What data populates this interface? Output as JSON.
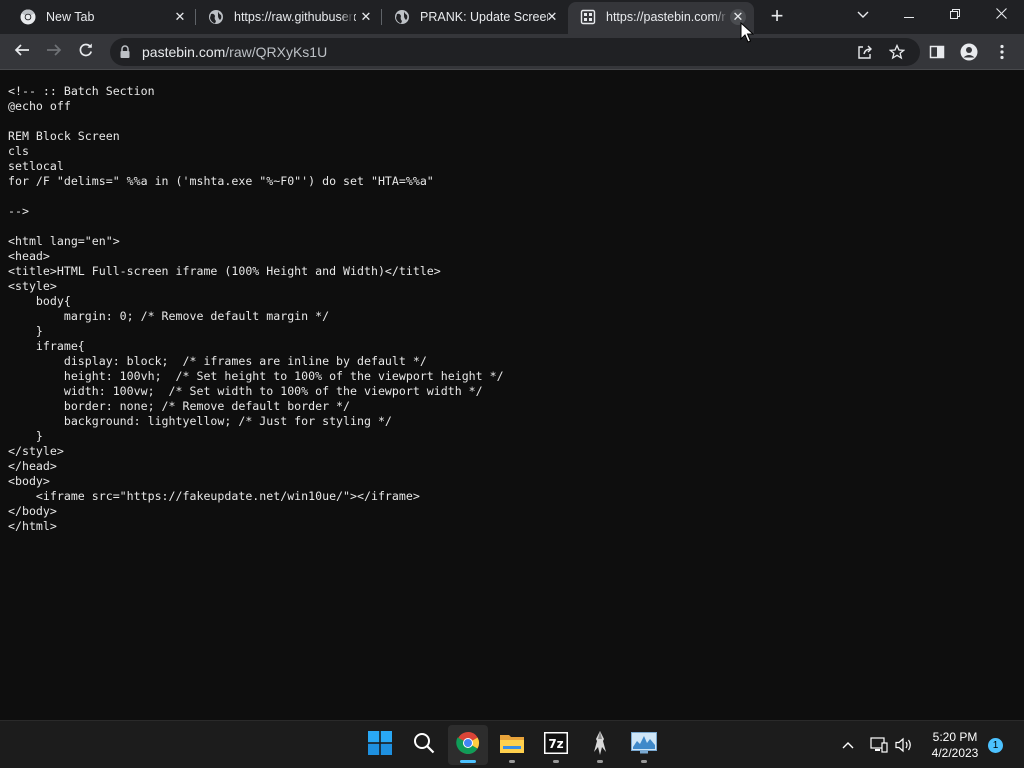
{
  "tabs": [
    {
      "title": "New Tab",
      "favicon": "chrome-icon"
    },
    {
      "title": "https://raw.githubuserc",
      "favicon": "globe-icon"
    },
    {
      "title": "PRANK: Update Screen",
      "favicon": "globe-icon"
    },
    {
      "title": "https://pastebin.com/r",
      "favicon": "pastebin-icon"
    }
  ],
  "toolbar": {
    "url_host": "pastebin.com",
    "url_path": "/raw/QRXyKs1U"
  },
  "page": {
    "lines": [
      "<!-- :: Batch Section",
      "@echo off",
      "",
      "REM Block Screen",
      "cls",
      "setlocal",
      "for /F \"delims=\" %%a in ('mshta.exe \"%~F0\"') do set \"HTA=%%a\"",
      "",
      "-->",
      "",
      "<html lang=\"en\">",
      "<head>",
      "<title>HTML Full-screen iframe (100% Height and Width)</title>",
      "<style>",
      "    body{",
      "        margin: 0; /* Remove default margin */",
      "    }",
      "    iframe{",
      "        display: block;  /* iframes are inline by default */",
      "        height: 100vh;  /* Set height to 100% of the viewport height */",
      "        width: 100vw;  /* Set width to 100% of the viewport width */",
      "        border: none; /* Remove default border */",
      "        background: lightyellow; /* Just for styling */",
      "    }",
      "</style>",
      "</head>",
      "<body>",
      "    <iframe src=\"https://fakeupdate.net/win10ue/\"></iframe>",
      "</body>",
      "</html>"
    ]
  },
  "taskbar": {
    "apps": [
      "start-icon",
      "search-icon",
      "chrome-icon",
      "file-explorer-icon",
      "7zip-icon",
      "inkscape-icon",
      "resource-monitor-icon"
    ],
    "time": "5:20 PM",
    "date": "4/2/2023",
    "notification_count": "1"
  },
  "colors": {
    "tabstrip_bg": "#202124",
    "active_tab_bg": "#35363a",
    "page_bg": "#0e0e0e",
    "taskbar_bg": "#1c1c1c",
    "accent": "#4cc2ff"
  }
}
